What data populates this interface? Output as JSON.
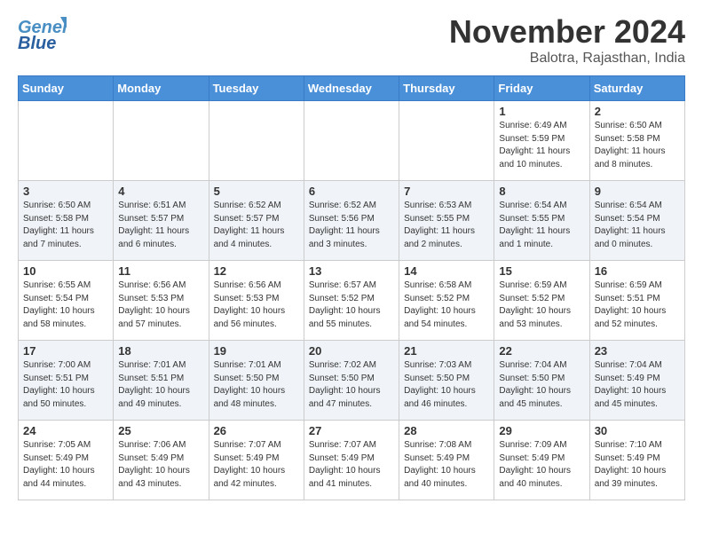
{
  "header": {
    "logo_general": "General",
    "logo_blue": "Blue",
    "month_title": "November 2024",
    "location": "Balotra, Rajasthan, India"
  },
  "days_of_week": [
    "Sunday",
    "Monday",
    "Tuesday",
    "Wednesday",
    "Thursday",
    "Friday",
    "Saturday"
  ],
  "weeks": [
    {
      "days": [
        {
          "num": "",
          "info": ""
        },
        {
          "num": "",
          "info": ""
        },
        {
          "num": "",
          "info": ""
        },
        {
          "num": "",
          "info": ""
        },
        {
          "num": "",
          "info": ""
        },
        {
          "num": "1",
          "info": "Sunrise: 6:49 AM\nSunset: 5:59 PM\nDaylight: 11 hours\nand 10 minutes."
        },
        {
          "num": "2",
          "info": "Sunrise: 6:50 AM\nSunset: 5:58 PM\nDaylight: 11 hours\nand 8 minutes."
        }
      ]
    },
    {
      "days": [
        {
          "num": "3",
          "info": "Sunrise: 6:50 AM\nSunset: 5:58 PM\nDaylight: 11 hours\nand 7 minutes."
        },
        {
          "num": "4",
          "info": "Sunrise: 6:51 AM\nSunset: 5:57 PM\nDaylight: 11 hours\nand 6 minutes."
        },
        {
          "num": "5",
          "info": "Sunrise: 6:52 AM\nSunset: 5:57 PM\nDaylight: 11 hours\nand 4 minutes."
        },
        {
          "num": "6",
          "info": "Sunrise: 6:52 AM\nSunset: 5:56 PM\nDaylight: 11 hours\nand 3 minutes."
        },
        {
          "num": "7",
          "info": "Sunrise: 6:53 AM\nSunset: 5:55 PM\nDaylight: 11 hours\nand 2 minutes."
        },
        {
          "num": "8",
          "info": "Sunrise: 6:54 AM\nSunset: 5:55 PM\nDaylight: 11 hours\nand 1 minute."
        },
        {
          "num": "9",
          "info": "Sunrise: 6:54 AM\nSunset: 5:54 PM\nDaylight: 11 hours\nand 0 minutes."
        }
      ]
    },
    {
      "days": [
        {
          "num": "10",
          "info": "Sunrise: 6:55 AM\nSunset: 5:54 PM\nDaylight: 10 hours\nand 58 minutes."
        },
        {
          "num": "11",
          "info": "Sunrise: 6:56 AM\nSunset: 5:53 PM\nDaylight: 10 hours\nand 57 minutes."
        },
        {
          "num": "12",
          "info": "Sunrise: 6:56 AM\nSunset: 5:53 PM\nDaylight: 10 hours\nand 56 minutes."
        },
        {
          "num": "13",
          "info": "Sunrise: 6:57 AM\nSunset: 5:52 PM\nDaylight: 10 hours\nand 55 minutes."
        },
        {
          "num": "14",
          "info": "Sunrise: 6:58 AM\nSunset: 5:52 PM\nDaylight: 10 hours\nand 54 minutes."
        },
        {
          "num": "15",
          "info": "Sunrise: 6:59 AM\nSunset: 5:52 PM\nDaylight: 10 hours\nand 53 minutes."
        },
        {
          "num": "16",
          "info": "Sunrise: 6:59 AM\nSunset: 5:51 PM\nDaylight: 10 hours\nand 52 minutes."
        }
      ]
    },
    {
      "days": [
        {
          "num": "17",
          "info": "Sunrise: 7:00 AM\nSunset: 5:51 PM\nDaylight: 10 hours\nand 50 minutes."
        },
        {
          "num": "18",
          "info": "Sunrise: 7:01 AM\nSunset: 5:51 PM\nDaylight: 10 hours\nand 49 minutes."
        },
        {
          "num": "19",
          "info": "Sunrise: 7:01 AM\nSunset: 5:50 PM\nDaylight: 10 hours\nand 48 minutes."
        },
        {
          "num": "20",
          "info": "Sunrise: 7:02 AM\nSunset: 5:50 PM\nDaylight: 10 hours\nand 47 minutes."
        },
        {
          "num": "21",
          "info": "Sunrise: 7:03 AM\nSunset: 5:50 PM\nDaylight: 10 hours\nand 46 minutes."
        },
        {
          "num": "22",
          "info": "Sunrise: 7:04 AM\nSunset: 5:50 PM\nDaylight: 10 hours\nand 45 minutes."
        },
        {
          "num": "23",
          "info": "Sunrise: 7:04 AM\nSunset: 5:49 PM\nDaylight: 10 hours\nand 45 minutes."
        }
      ]
    },
    {
      "days": [
        {
          "num": "24",
          "info": "Sunrise: 7:05 AM\nSunset: 5:49 PM\nDaylight: 10 hours\nand 44 minutes."
        },
        {
          "num": "25",
          "info": "Sunrise: 7:06 AM\nSunset: 5:49 PM\nDaylight: 10 hours\nand 43 minutes."
        },
        {
          "num": "26",
          "info": "Sunrise: 7:07 AM\nSunset: 5:49 PM\nDaylight: 10 hours\nand 42 minutes."
        },
        {
          "num": "27",
          "info": "Sunrise: 7:07 AM\nSunset: 5:49 PM\nDaylight: 10 hours\nand 41 minutes."
        },
        {
          "num": "28",
          "info": "Sunrise: 7:08 AM\nSunset: 5:49 PM\nDaylight: 10 hours\nand 40 minutes."
        },
        {
          "num": "29",
          "info": "Sunrise: 7:09 AM\nSunset: 5:49 PM\nDaylight: 10 hours\nand 40 minutes."
        },
        {
          "num": "30",
          "info": "Sunrise: 7:10 AM\nSunset: 5:49 PM\nDaylight: 10 hours\nand 39 minutes."
        }
      ]
    }
  ]
}
